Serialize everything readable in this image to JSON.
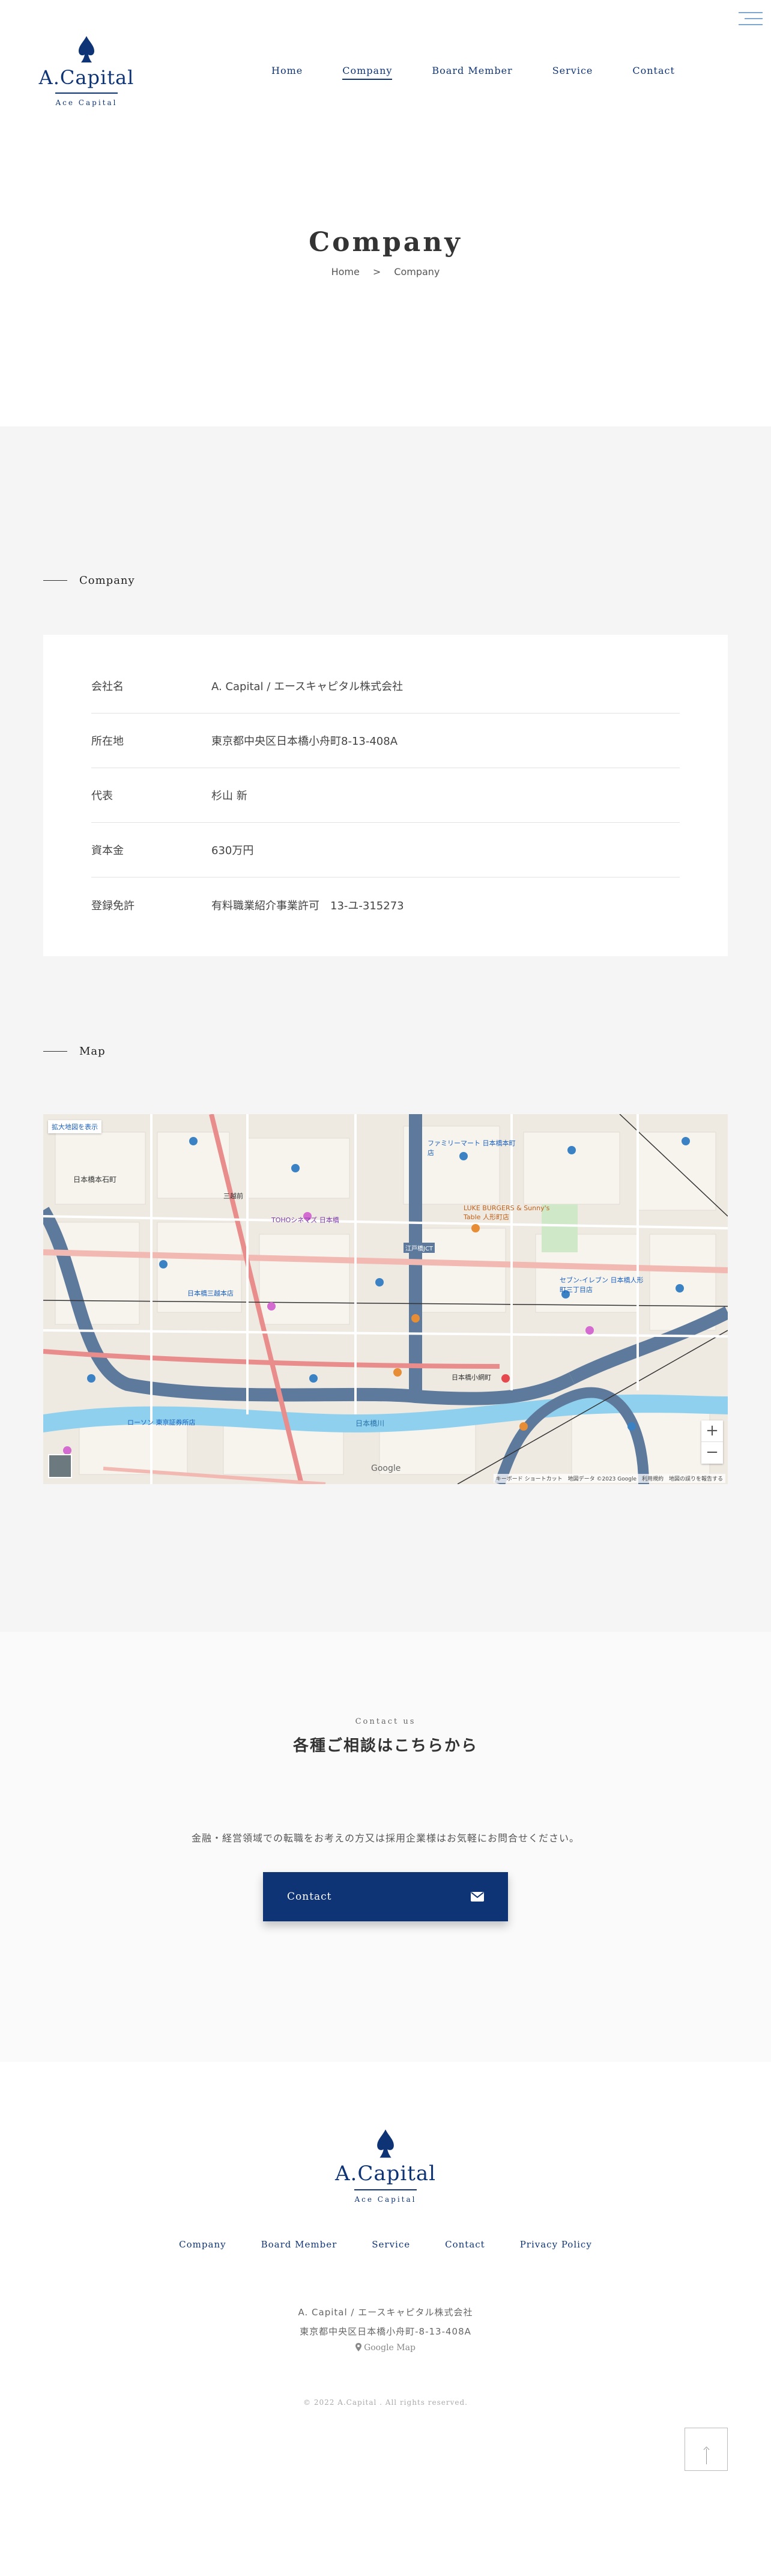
{
  "header": {
    "logo_name": "A.Capital",
    "logo_sub": "Ace Capital",
    "nav": [
      "Home",
      "Company",
      "Board Member",
      "Service",
      "Contact"
    ]
  },
  "page": {
    "title": "Company",
    "breadcrumb_home": "Home",
    "breadcrumb_sep": ">",
    "breadcrumb_current": "Company"
  },
  "company": {
    "heading": "Company",
    "rows": [
      {
        "label": "会社名",
        "value": "A. Capital / エースキャピタル株式会社"
      },
      {
        "label": "所在地",
        "value": "東京都中央区日本橋小舟町8-13-408A"
      },
      {
        "label": "代表",
        "value": "杉山 新"
      },
      {
        "label": "資本金",
        "value": "630万円"
      },
      {
        "label": "登録免許",
        "value": "有料職業紹介事業許可　13-ユ-315273"
      }
    ]
  },
  "map": {
    "heading": "Map",
    "expand_label": "拡大地図を表示",
    "attribution": "キーボード ショートカット　地図データ ©2023 Google　利用規約　地図の誤りを報告する",
    "google_label": "Google",
    "zoom_in": "+",
    "zoom_out": "−",
    "labels": [
      "日本橋小網町",
      "三越前",
      "TOHOシネマズ 日本橋",
      "日本橋三越本店",
      "江戸橋JCT",
      "LUKE BURGERS & Sunny's Table 人形町店",
      "セブン-イレブン 日本橋人形町三丁目店",
      "日本橋川",
      "ファミリーマート 日本橋本町店",
      "日本橋本石町",
      "ローソン 東京証券所店"
    ]
  },
  "contact": {
    "eyebrow": "Contact us",
    "title": "各種ご相談はこちらから",
    "text": "金融・経営領域での転職をお考えの方又は採用企業様はお気軽にお問合せください。",
    "button_label": "Contact",
    "icon": "envelope-icon"
  },
  "footer": {
    "logo_name": "A.Capital",
    "logo_sub": "Ace Capital",
    "nav": [
      "Company",
      "Board Member",
      "Service",
      "Contact",
      "Privacy Policy"
    ],
    "company_name": "A. Capital / エースキャピタル株式会社",
    "address": "東京都中央区日本橋小舟町-8-13-408A",
    "map_link": "Google Map",
    "copyright": "© 2022 A.Capital . All rights reserved."
  },
  "colors": {
    "brand": "#0f3476",
    "section_bg": "#f5f5f5"
  }
}
